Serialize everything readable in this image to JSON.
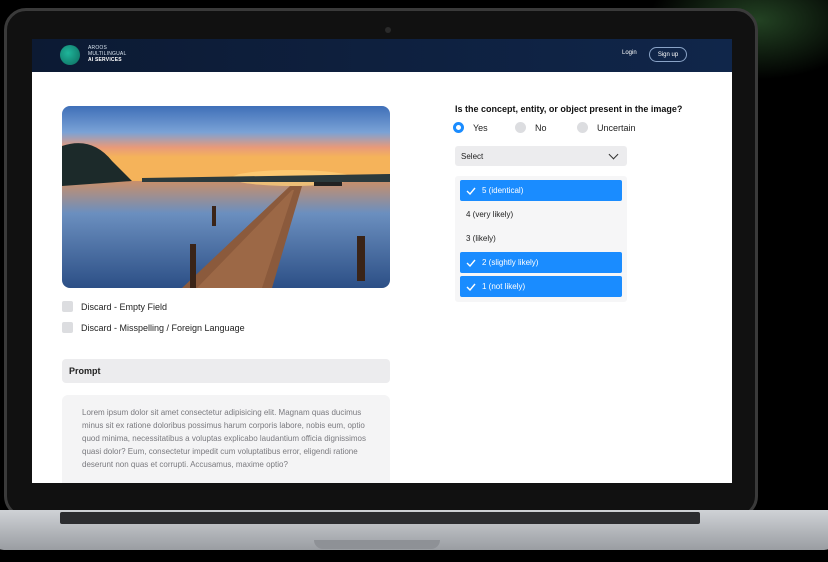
{
  "header": {
    "brand_line1": "AROOS",
    "brand_line2": "MULTILINGUAL",
    "brand_line3": "AI SERVICES",
    "login_label": "Login",
    "signup_label": "Sign up"
  },
  "left": {
    "checkbox1_label": "Discard - Empty Field",
    "checkbox2_label": "Discard - Misspelling / Foreign Language",
    "prompt_label": "Prompt",
    "prompt_text": "Lorem ipsum dolor sit amet consectetur adipisicing elit. Magnam quas ducimus minus sit ex ratione doloribus possimus harum corporis labore, nobis eum, optio quod minima, necessitatibus a voluptas explicabo laudantium officia dignissimos quasi dolor? Eum, consectetur impedit cum voluptatibus error, eligendi ratione deserunt non quas et corrupti. Accusamus, maxime optio?"
  },
  "right": {
    "question": "Is the concept, entity, or object present in the image?",
    "radios": [
      {
        "label": "Yes",
        "selected": true
      },
      {
        "label": "No",
        "selected": false
      },
      {
        "label": "Uncertain",
        "selected": false
      }
    ],
    "select_label": "Select",
    "options": [
      {
        "label": "5 (identical)",
        "checked": true
      },
      {
        "label": "4 (very likely)",
        "checked": false
      },
      {
        "label": "3 (likely)",
        "checked": false
      },
      {
        "label": "2 (slightly likely)",
        "checked": true
      },
      {
        "label": "1 (not likely)",
        "checked": true
      }
    ]
  },
  "colors": {
    "accent": "#1a8cff",
    "header_bg": "#0c1a33"
  }
}
